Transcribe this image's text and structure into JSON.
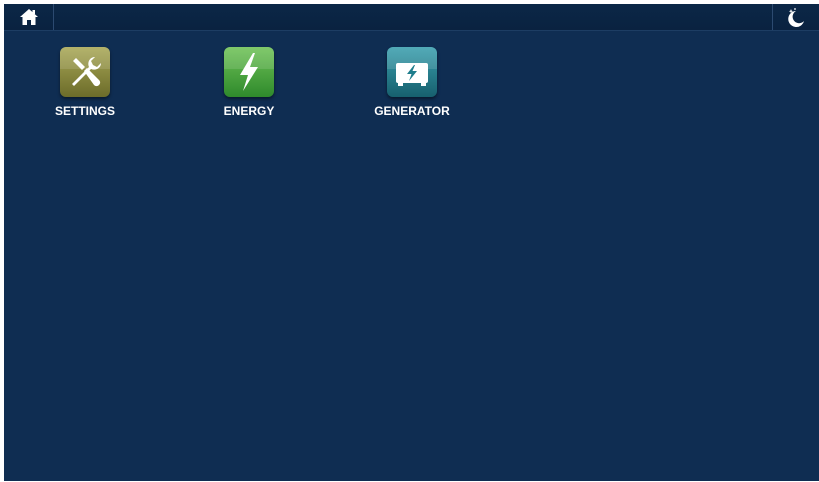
{
  "topbar": {
    "home_icon": "home-icon",
    "night_mode_icon": "moon-stars-icon"
  },
  "apps": [
    {
      "id": "settings",
      "label": "SETTINGS",
      "icon": "tools-icon",
      "color": "#8a8a3a"
    },
    {
      "id": "energy",
      "label": "ENERGY",
      "icon": "lightning-icon",
      "color": "#4ea83c"
    },
    {
      "id": "generator",
      "label": "GENERATOR",
      "icon": "generator-icon",
      "color": "#1e7d8c"
    }
  ],
  "colors": {
    "background": "#0f2d52",
    "topbar": "#0a2240"
  }
}
